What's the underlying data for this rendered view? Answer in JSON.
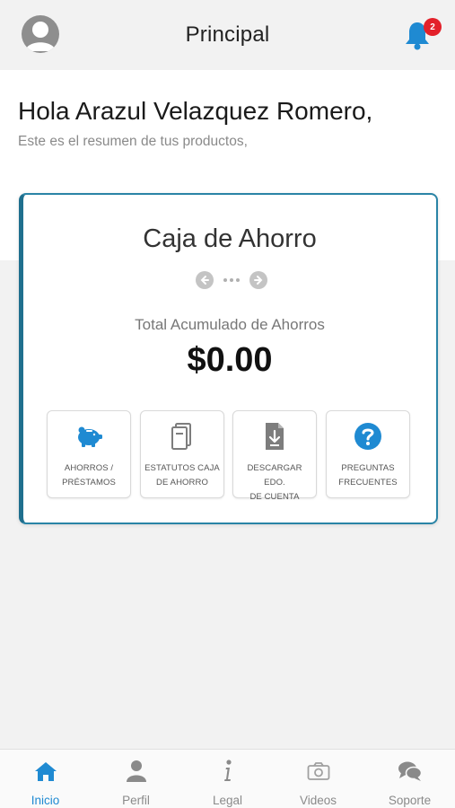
{
  "header": {
    "title": "Principal",
    "notification_count": "2"
  },
  "greeting": {
    "title": "Hola Arazul Velazquez Romero,",
    "subtitle": "Este es el resumen de tus productos,"
  },
  "card": {
    "title": "Caja de Ahorro",
    "total_label": "Total Acumulado de Ahorros",
    "total_value": "$0.00",
    "tiles": [
      {
        "label_line1": "AHORROS /",
        "label_line2": "PRÉSTAMOS",
        "icon": "piggy-bank-icon"
      },
      {
        "label_line1": "ESTATUTOS CAJA",
        "label_line2": "DE AHORRO",
        "icon": "document-icon"
      },
      {
        "label_line1": "DESCARGAR EDO.",
        "label_line2": "DE CUENTA",
        "icon": "download-file-icon"
      },
      {
        "label_line1": "PREGUNTAS",
        "label_line2": "FRECUENTES",
        "icon": "question-icon"
      }
    ]
  },
  "nav": {
    "items": [
      {
        "label": "Inicio",
        "icon": "home-icon",
        "active": true
      },
      {
        "label": "Perfil",
        "icon": "person-icon",
        "active": false
      },
      {
        "label": "Legal",
        "icon": "info-icon",
        "active": false
      },
      {
        "label": "Videos",
        "icon": "camera-icon",
        "active": false
      },
      {
        "label": "Soporte",
        "icon": "chat-icon",
        "active": false
      }
    ]
  },
  "colors": {
    "accent": "#1f8ad2",
    "card_border": "#2a84a6",
    "badge": "#e3202a",
    "icon_gray": "#7d7d7d"
  }
}
